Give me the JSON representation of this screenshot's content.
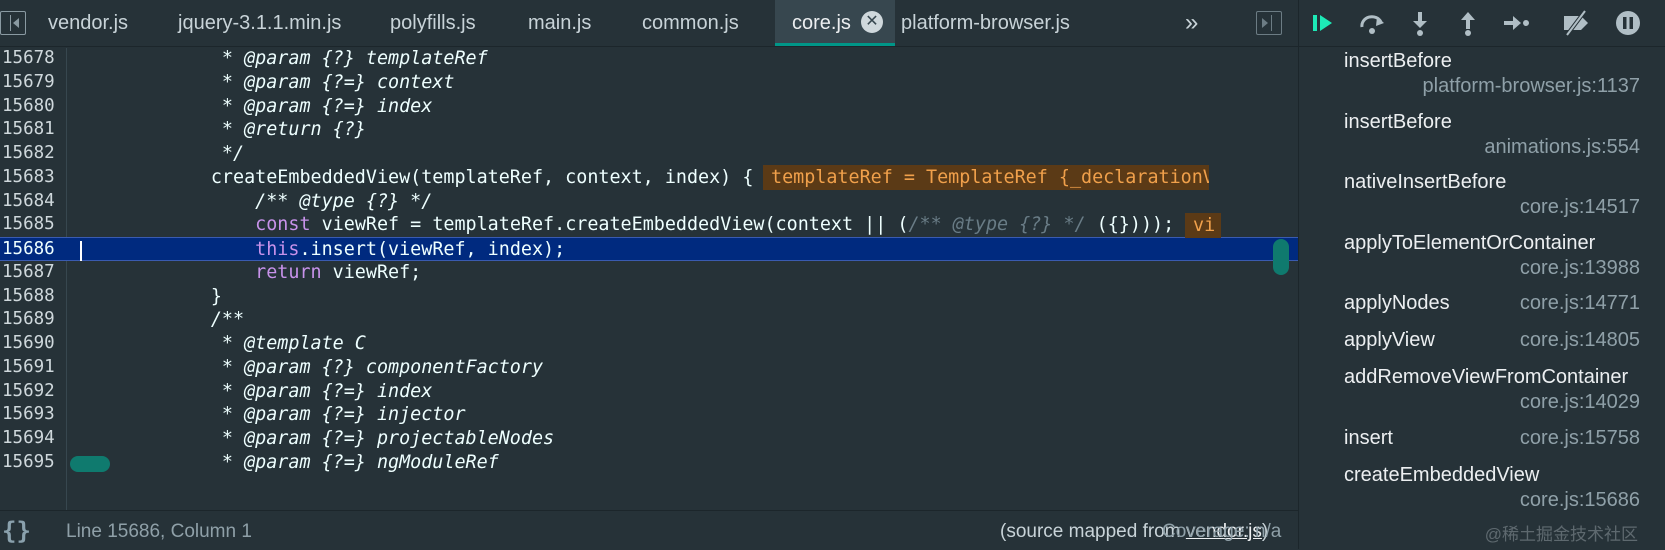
{
  "tabs": [
    {
      "label": "vendor.js",
      "active": false
    },
    {
      "label": "jquery-3.1.1.min.js",
      "active": false
    },
    {
      "label": "polyfills.js",
      "active": false
    },
    {
      "label": "main.js",
      "active": false
    },
    {
      "label": "common.js",
      "active": false
    },
    {
      "label": "core.js",
      "active": true
    },
    {
      "label": "platform-browser.js",
      "active": false
    }
  ],
  "more_tabs_glyph": "»",
  "close_glyph": "✕",
  "code_lines": [
    {
      "num": "15678",
      "text": "             * @param {?} templateRef",
      "kind": "comment"
    },
    {
      "num": "15679",
      "text": "             * @param {?=} context",
      "kind": "comment"
    },
    {
      "num": "15680",
      "text": "             * @param {?=} index",
      "kind": "comment"
    },
    {
      "num": "15681",
      "text": "             * @return {?}",
      "kind": "comment"
    },
    {
      "num": "15682",
      "text": "             */",
      "kind": "comment"
    },
    {
      "num": "15683",
      "text": "            createEmbeddedView(templateRef, context, index) {",
      "kind": "code"
    },
    {
      "num": "15684",
      "text": "                /** @type {?} */",
      "kind": "comment"
    },
    {
      "num": "15685",
      "text": "                const viewRef = templateRef.createEmbeddedView(context || (/** @type {?} */ ({})));",
      "kind": "const"
    },
    {
      "num": "15686",
      "text": "                this.insert(viewRef, index);",
      "kind": "this"
    },
    {
      "num": "15687",
      "text": "                return viewRef;",
      "kind": "return"
    },
    {
      "num": "15688",
      "text": "            }",
      "kind": "code"
    },
    {
      "num": "15689",
      "text": "            /**",
      "kind": "comment"
    },
    {
      "num": "15690",
      "text": "             * @template C",
      "kind": "comment"
    },
    {
      "num": "15691",
      "text": "             * @param {?} componentFactory",
      "kind": "comment"
    },
    {
      "num": "15692",
      "text": "             * @param {?=} index",
      "kind": "comment"
    },
    {
      "num": "15693",
      "text": "             * @param {?=} injector",
      "kind": "comment"
    },
    {
      "num": "15694",
      "text": "             * @param {?=} projectableNodes",
      "kind": "comment"
    },
    {
      "num": "15695",
      "text": "             * @param {?=} ngModuleRef",
      "kind": "comment"
    }
  ],
  "current_line": "15686",
  "inline_values": {
    "line_15683": "templateRef = TemplateRef {_declarationV",
    "line_15685": "vi"
  },
  "status": {
    "braces": "{}",
    "position": "Line 15686, Column 1",
    "source_prefix": "(source mapped from ",
    "source_link": "vendor.js",
    "source_suffix": ")",
    "coverage": "Coverage: n/a"
  },
  "call_stack": [
    {
      "name": "insertBefore",
      "location": "platform-browser.js:1137",
      "layout": "two"
    },
    {
      "name": "insertBefore",
      "location": "animations.js:554",
      "layout": "two"
    },
    {
      "name": "nativeInsertBefore",
      "location": "core.js:14517",
      "layout": "two"
    },
    {
      "name": "applyToElementOrContainer",
      "location": "core.js:13988",
      "layout": "two"
    },
    {
      "name": "applyNodes",
      "location": "core.js:14771",
      "layout": "one"
    },
    {
      "name": "applyView",
      "location": "core.js:14805",
      "layout": "one"
    },
    {
      "name": "addRemoveViewFromContainer",
      "location": "core.js:14029",
      "layout": "two"
    },
    {
      "name": "insert",
      "location": "core.js:15758",
      "layout": "one"
    },
    {
      "name": "createEmbeddedView",
      "location": "core.js:15686",
      "layout": "two"
    }
  ],
  "watermark": "@稀土掘金技术社区",
  "colors": {
    "accent": "#009688",
    "background": "#263238",
    "inline_value_bg": "#5b3a16",
    "current_line_bg": "#002a7f"
  }
}
